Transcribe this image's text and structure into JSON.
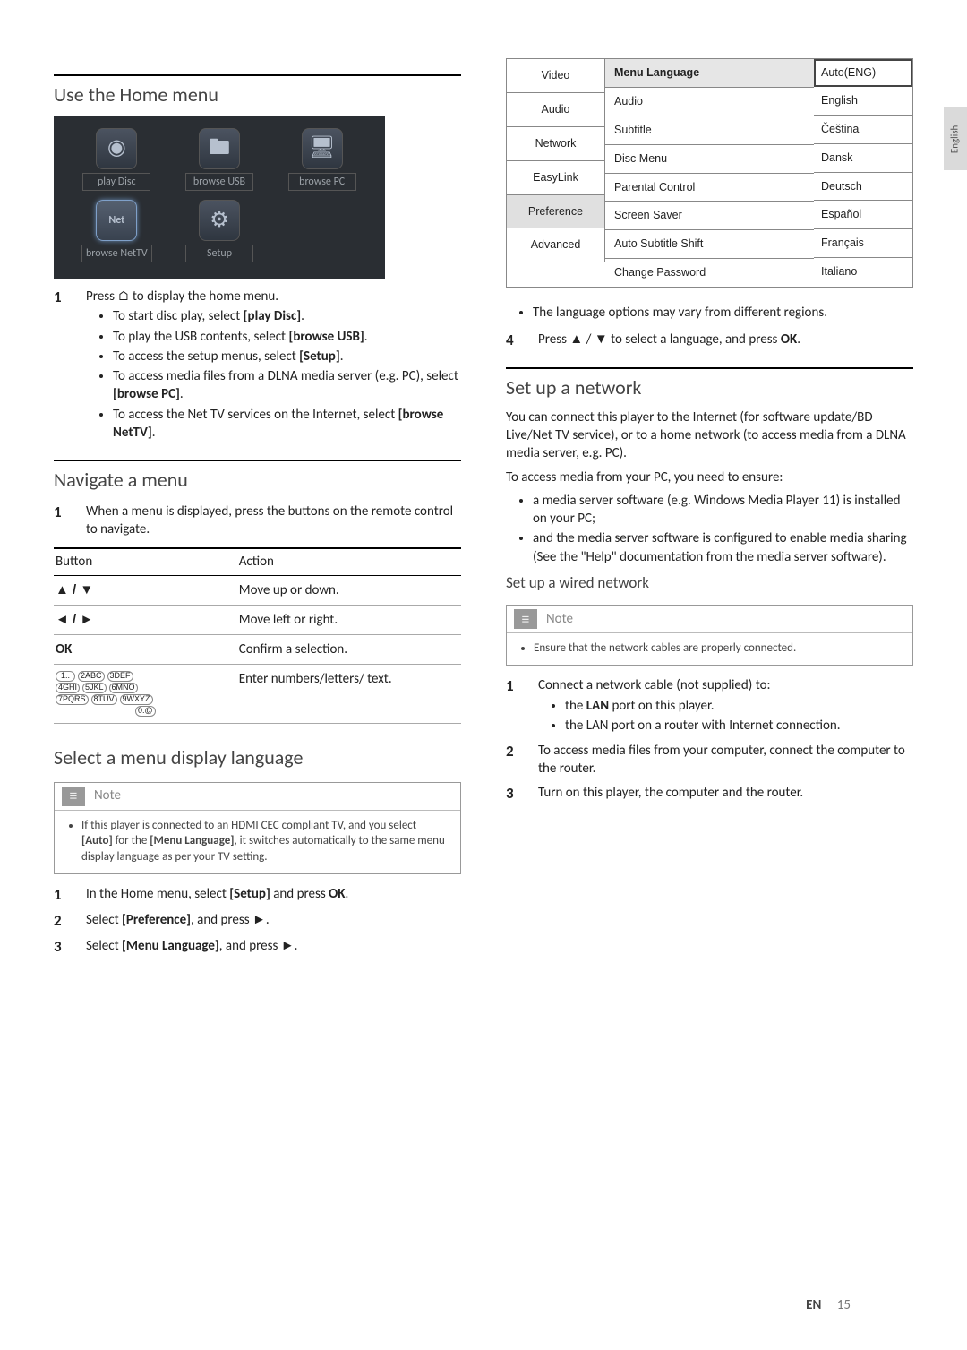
{
  "sideTab": "English",
  "footer": {
    "lang": "EN",
    "page": "15"
  },
  "homeMenu": {
    "heading": "Use the Home menu",
    "tiles": [
      {
        "name": "play-disc",
        "label": "play Disc",
        "glyph": "◉"
      },
      {
        "name": "browse-usb",
        "label": "browse USB",
        "glyph": "🖿"
      },
      {
        "name": "browse-pc",
        "label": "browse PC",
        "glyph": "🖥"
      },
      {
        "name": "browse-nettv",
        "label": "browse NetTV",
        "glyph": "Net"
      },
      {
        "name": "setup",
        "label": "Setup",
        "glyph": "⚙"
      }
    ],
    "step1": "Press ⌂ to display the home menu.",
    "bullets": [
      "To start disc play, select [play Disc].",
      "To play the USB contents, select [browse USB].",
      "To access the setup menus, select [Setup].",
      "To access media files from a DLNA media server (e.g. PC), select [browse PC].",
      "To access the Net TV services on the Internet, select [browse NetTV]."
    ]
  },
  "navigate": {
    "heading": "Navigate a menu",
    "step1": "When a menu is displayed, press the buttons on the remote control to navigate.",
    "th1": "Button",
    "th2": "Action",
    "rows": [
      {
        "btn": "▲ / ▼",
        "act": "Move up or down."
      },
      {
        "btn": "◄ / ►",
        "act": "Move left or right."
      },
      {
        "btn": "OK",
        "act": "Confirm a selection."
      },
      {
        "btn": "keypad",
        "act": "Enter numbers/letters/ text."
      }
    ]
  },
  "language": {
    "heading": "Select a menu display language",
    "noteTitle": "Note",
    "noteBody": "If this player is connected to an HDMI CEC compliant TV, and you select [Auto] for the [Menu Language], it switches automatically to the same menu display language as per your TV setting.",
    "steps": [
      "In the Home menu, select [Setup] and press OK.",
      "Select [Preference], and press ►.",
      "Select [Menu Language], and press ►."
    ]
  },
  "settingsMenu": {
    "leftTabs": [
      "Video",
      "Audio",
      "Network",
      "EasyLink",
      "Preference",
      "Advanced"
    ],
    "selectedTab": "Preference",
    "options": [
      "Menu Language",
      "Audio",
      "Subtitle",
      "Disc Menu",
      "Parental Control",
      "Screen Saver",
      "Auto Subtitle Shift",
      "Change Password"
    ],
    "selectedOption": "Menu Language",
    "values": [
      "Auto(ENG)",
      "English",
      "Čeština",
      "Dansk",
      "Deutsch",
      "Español",
      "Français",
      "Italiano"
    ],
    "selectedValue": "Auto(ENG)",
    "afterBullets": [
      "The language options may vary from different regions."
    ],
    "step4": "Press ▲ / ▼ to select a language, and press OK."
  },
  "network": {
    "heading": "Set up a network",
    "intro": "You can connect this player to the Internet (for software update/BD Live/Net TV service), or to a home network (to access media from a DLNA media server, e.g. PC).",
    "ensure": "To access media from your PC, you need to ensure:",
    "ensureBullets": [
      "a media server software (e.g. Windows Media Player 11) is installed on your PC;",
      "and the media server software is configured to enable media sharing (See the \"Help\" documentation from the media server software)."
    ],
    "wiredHeading": "Set up a wired network",
    "noteTitle": "Note",
    "noteBody": "Ensure that the network cables are properly connected.",
    "steps": {
      "s1": "Connect a network cable (not supplied) to:",
      "s1b": [
        "the LAN port on this player.",
        "the LAN port on a router with Internet connection."
      ],
      "s2": "To access media files from your computer, connect the computer to the router.",
      "s3": "Turn on this player, the computer and the router."
    }
  }
}
